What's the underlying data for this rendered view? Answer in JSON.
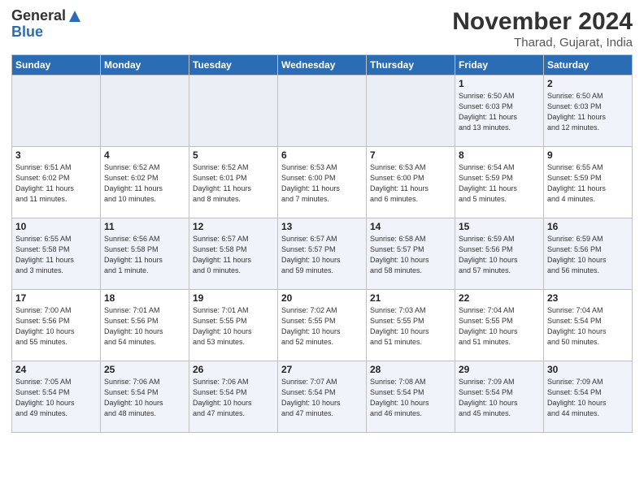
{
  "header": {
    "logo_general": "General",
    "logo_blue": "Blue",
    "month_title": "November 2024",
    "location": "Tharad, Gujarat, India"
  },
  "days_of_week": [
    "Sunday",
    "Monday",
    "Tuesday",
    "Wednesday",
    "Thursday",
    "Friday",
    "Saturday"
  ],
  "weeks": [
    [
      {
        "day": "",
        "detail": ""
      },
      {
        "day": "",
        "detail": ""
      },
      {
        "day": "",
        "detail": ""
      },
      {
        "day": "",
        "detail": ""
      },
      {
        "day": "",
        "detail": ""
      },
      {
        "day": "1",
        "detail": "Sunrise: 6:50 AM\nSunset: 6:03 PM\nDaylight: 11 hours\nand 13 minutes."
      },
      {
        "day": "2",
        "detail": "Sunrise: 6:50 AM\nSunset: 6:03 PM\nDaylight: 11 hours\nand 12 minutes."
      }
    ],
    [
      {
        "day": "3",
        "detail": "Sunrise: 6:51 AM\nSunset: 6:02 PM\nDaylight: 11 hours\nand 11 minutes."
      },
      {
        "day": "4",
        "detail": "Sunrise: 6:52 AM\nSunset: 6:02 PM\nDaylight: 11 hours\nand 10 minutes."
      },
      {
        "day": "5",
        "detail": "Sunrise: 6:52 AM\nSunset: 6:01 PM\nDaylight: 11 hours\nand 8 minutes."
      },
      {
        "day": "6",
        "detail": "Sunrise: 6:53 AM\nSunset: 6:00 PM\nDaylight: 11 hours\nand 7 minutes."
      },
      {
        "day": "7",
        "detail": "Sunrise: 6:53 AM\nSunset: 6:00 PM\nDaylight: 11 hours\nand 6 minutes."
      },
      {
        "day": "8",
        "detail": "Sunrise: 6:54 AM\nSunset: 5:59 PM\nDaylight: 11 hours\nand 5 minutes."
      },
      {
        "day": "9",
        "detail": "Sunrise: 6:55 AM\nSunset: 5:59 PM\nDaylight: 11 hours\nand 4 minutes."
      }
    ],
    [
      {
        "day": "10",
        "detail": "Sunrise: 6:55 AM\nSunset: 5:58 PM\nDaylight: 11 hours\nand 3 minutes."
      },
      {
        "day": "11",
        "detail": "Sunrise: 6:56 AM\nSunset: 5:58 PM\nDaylight: 11 hours\nand 1 minute."
      },
      {
        "day": "12",
        "detail": "Sunrise: 6:57 AM\nSunset: 5:58 PM\nDaylight: 11 hours\nand 0 minutes."
      },
      {
        "day": "13",
        "detail": "Sunrise: 6:57 AM\nSunset: 5:57 PM\nDaylight: 10 hours\nand 59 minutes."
      },
      {
        "day": "14",
        "detail": "Sunrise: 6:58 AM\nSunset: 5:57 PM\nDaylight: 10 hours\nand 58 minutes."
      },
      {
        "day": "15",
        "detail": "Sunrise: 6:59 AM\nSunset: 5:56 PM\nDaylight: 10 hours\nand 57 minutes."
      },
      {
        "day": "16",
        "detail": "Sunrise: 6:59 AM\nSunset: 5:56 PM\nDaylight: 10 hours\nand 56 minutes."
      }
    ],
    [
      {
        "day": "17",
        "detail": "Sunrise: 7:00 AM\nSunset: 5:56 PM\nDaylight: 10 hours\nand 55 minutes."
      },
      {
        "day": "18",
        "detail": "Sunrise: 7:01 AM\nSunset: 5:56 PM\nDaylight: 10 hours\nand 54 minutes."
      },
      {
        "day": "19",
        "detail": "Sunrise: 7:01 AM\nSunset: 5:55 PM\nDaylight: 10 hours\nand 53 minutes."
      },
      {
        "day": "20",
        "detail": "Sunrise: 7:02 AM\nSunset: 5:55 PM\nDaylight: 10 hours\nand 52 minutes."
      },
      {
        "day": "21",
        "detail": "Sunrise: 7:03 AM\nSunset: 5:55 PM\nDaylight: 10 hours\nand 51 minutes."
      },
      {
        "day": "22",
        "detail": "Sunrise: 7:04 AM\nSunset: 5:55 PM\nDaylight: 10 hours\nand 51 minutes."
      },
      {
        "day": "23",
        "detail": "Sunrise: 7:04 AM\nSunset: 5:54 PM\nDaylight: 10 hours\nand 50 minutes."
      }
    ],
    [
      {
        "day": "24",
        "detail": "Sunrise: 7:05 AM\nSunset: 5:54 PM\nDaylight: 10 hours\nand 49 minutes."
      },
      {
        "day": "25",
        "detail": "Sunrise: 7:06 AM\nSunset: 5:54 PM\nDaylight: 10 hours\nand 48 minutes."
      },
      {
        "day": "26",
        "detail": "Sunrise: 7:06 AM\nSunset: 5:54 PM\nDaylight: 10 hours\nand 47 minutes."
      },
      {
        "day": "27",
        "detail": "Sunrise: 7:07 AM\nSunset: 5:54 PM\nDaylight: 10 hours\nand 47 minutes."
      },
      {
        "day": "28",
        "detail": "Sunrise: 7:08 AM\nSunset: 5:54 PM\nDaylight: 10 hours\nand 46 minutes."
      },
      {
        "day": "29",
        "detail": "Sunrise: 7:09 AM\nSunset: 5:54 PM\nDaylight: 10 hours\nand 45 minutes."
      },
      {
        "day": "30",
        "detail": "Sunrise: 7:09 AM\nSunset: 5:54 PM\nDaylight: 10 hours\nand 44 minutes."
      }
    ]
  ]
}
